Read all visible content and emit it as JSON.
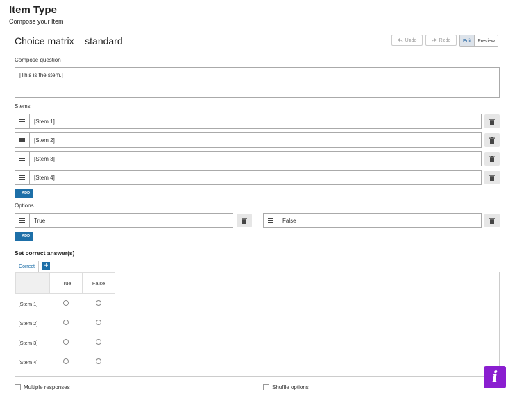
{
  "page": {
    "title": "Item Type",
    "subtitle": "Compose your Item"
  },
  "widget": {
    "title": "Choice matrix – standard"
  },
  "toolbar": {
    "undo": "Undo",
    "redo": "Redo",
    "edit": "Edit",
    "preview": "Preview"
  },
  "compose": {
    "label": "Compose question",
    "value": "[This is the stem.]"
  },
  "stems": {
    "label": "Stems",
    "items": [
      "[Stem 1]",
      "[Stem 2]",
      "[Stem 3]",
      "[Stem 4]"
    ],
    "add_label": "ADD"
  },
  "options": {
    "label": "Options",
    "items": [
      "True",
      "False"
    ],
    "add_label": "ADD"
  },
  "answers": {
    "title": "Set correct answer(s)",
    "tab_label": "Correct",
    "columns": [
      "True",
      "False"
    ],
    "rows": [
      "[Stem 1]",
      "[Stem 2]",
      "[Stem 3]",
      "[Stem 4]"
    ]
  },
  "settings": {
    "multiple": "Multiple responses",
    "shuffle": "Shuffle options"
  },
  "colors": {
    "accent": "#1d6fa8",
    "info": "#8a1ed0"
  },
  "icons": {
    "undo": "undo-icon",
    "redo": "redo-icon",
    "drag": "drag-handle-icon",
    "trash": "trash-icon",
    "plus": "plus-icon",
    "info": "info-icon"
  }
}
